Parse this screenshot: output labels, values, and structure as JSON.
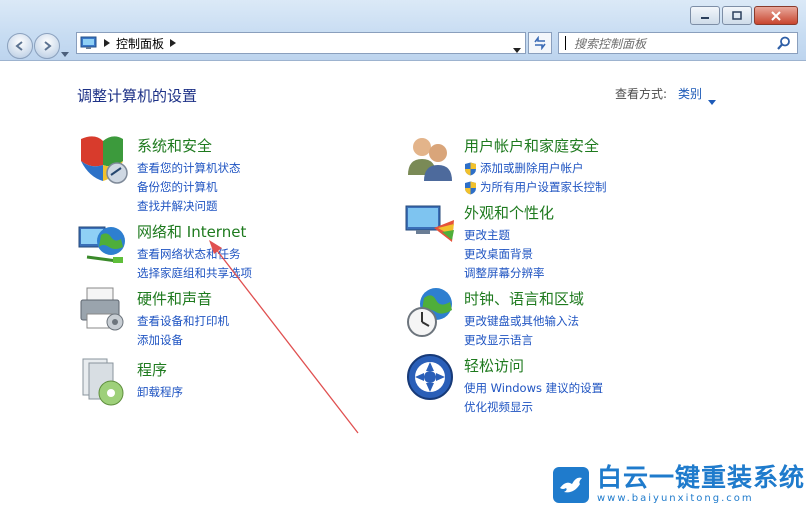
{
  "window": {
    "minimize_icon": "minimize-icon",
    "maximize_icon": "maximize-icon",
    "close_icon": "close-icon"
  },
  "address": {
    "path": "控制面板",
    "icon": "control-panel-icon"
  },
  "search": {
    "placeholder": "搜索控制面板",
    "icon": "search-icon"
  },
  "heading": "调整计算机的设置",
  "view": {
    "label": "查看方式:",
    "value": "类别"
  },
  "categories": {
    "system": {
      "title": "系统和安全",
      "links": [
        "查看您的计算机状态",
        "备份您的计算机",
        "查找并解决问题"
      ]
    },
    "network": {
      "title": "网络和 Internet",
      "links": [
        "查看网络状态和任务",
        "选择家庭组和共享选项"
      ]
    },
    "hardware": {
      "title": "硬件和声音",
      "links": [
        "查看设备和打印机",
        "添加设备"
      ]
    },
    "programs": {
      "title": "程序",
      "links": [
        "卸载程序"
      ]
    },
    "users": {
      "title": "用户帐户和家庭安全",
      "links": [
        "添加或删除用户帐户",
        "为所有用户设置家长控制"
      ]
    },
    "appearance": {
      "title": "外观和个性化",
      "links": [
        "更改主题",
        "更改桌面背景",
        "调整屏幕分辨率"
      ]
    },
    "clock": {
      "title": "时钟、语言和区域",
      "links": [
        "更改键盘或其他输入法",
        "更改显示语言"
      ]
    },
    "access": {
      "title": "轻松访问",
      "links": [
        "使用 Windows 建议的设置",
        "优化视频显示"
      ]
    }
  },
  "watermark": {
    "cn": "白云一键重装系统",
    "en": "www.baiyunxitong.com"
  },
  "colors": {
    "title_green": "#1e7a1e",
    "link_blue": "#1f54c2",
    "heading_blue": "#1e3287",
    "annotation_red": "#e05050"
  }
}
